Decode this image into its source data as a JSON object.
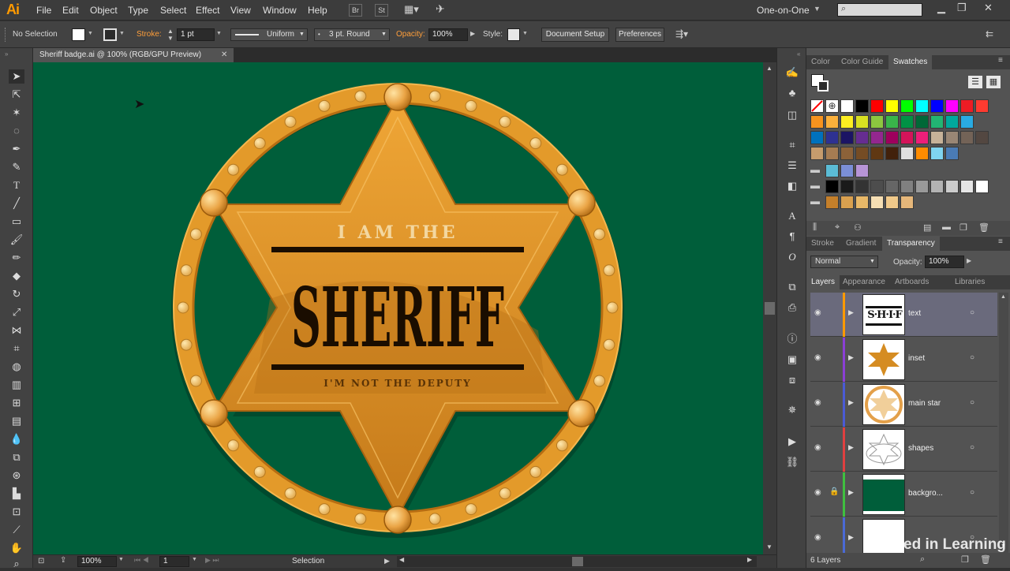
{
  "menubar": {
    "app_logo": "Ai",
    "menus": [
      "File",
      "Edit",
      "Object",
      "Type",
      "Select",
      "Effect",
      "View",
      "Window",
      "Help"
    ],
    "bridge_label": "Br",
    "stock_label": "St",
    "workspace": "One-on-One"
  },
  "control": {
    "selection_status": "No Selection",
    "stroke_label": "Stroke:",
    "stroke_weight": "1 pt",
    "profile": "Uniform",
    "brush": "3 pt. Round",
    "opacity_label": "Opacity:",
    "opacity_value": "100%",
    "style_label": "Style:",
    "document_setup": "Document Setup",
    "preferences": "Preferences"
  },
  "document": {
    "tab_title": "Sheriff badge.ai @ 100% (RGB/GPU Preview)",
    "canvas_color": "#005e3a"
  },
  "artwork": {
    "line1": "I AM THE",
    "line2": "SHERIFF",
    "line3": "I'M NOT THE DEPUTY",
    "gold": "#e39a2a",
    "gold_dark": "#b66d12"
  },
  "status": {
    "zoom": "100%",
    "artboard": "1",
    "tool": "Selection"
  },
  "panels": {
    "swatch_tabs": [
      "Color",
      "Color Guide",
      "Swatches"
    ],
    "swatch_rows": [
      [
        "#ff0000",
        "#ffff00",
        "#00ff00",
        "#00ffff",
        "#0000ff",
        "#ff00ff",
        "#ed1c24",
        "#ff3b30"
      ],
      [
        "#f7931e",
        "#fbb03b",
        "#fcee21",
        "#d9e021",
        "#8cc63f",
        "#39b54a",
        "#009245",
        "#006837",
        "#22b573",
        "#00a99d",
        "#29abe2"
      ],
      [
        "#0071bc",
        "#2e3192",
        "#1b1464",
        "#662d91",
        "#93278f",
        "#9e005d",
        "#d4145a",
        "#ed1e79",
        "#c7b299",
        "#998675",
        "#736357",
        "#534741"
      ],
      [
        "#c69c6d",
        "#a67c52",
        "#8c6239",
        "#754c24",
        "#603813",
        "#42210b",
        "#e0e0e0",
        "#ff8c00",
        "#7fd4f0",
        "#4a7bb5"
      ],
      [
        "#5bbcd6",
        "#7b8fd6",
        "#b794d6"
      ],
      [
        "#000000",
        "#1a1a1a",
        "#333333",
        "#4d4d4d",
        "#666666",
        "#808080",
        "#999999",
        "#b3b3b3",
        "#cccccc",
        "#e6e6e6",
        "#ffffff"
      ],
      [
        "#c47f2a",
        "#d9a04f",
        "#e8b868",
        "#f5deb3",
        "#f0c98a",
        "#e6b77a"
      ]
    ],
    "stroke_tabs": [
      "Stroke",
      "Gradient",
      "Transparency"
    ],
    "blend_mode": "Normal",
    "opacity_label": "Opacity:",
    "opacity_value": "100%",
    "layers_tabs": [
      "Layers",
      "Appearance",
      "Artboards",
      "Libraries"
    ],
    "layers": [
      {
        "name": "text",
        "color": "#ff9a00",
        "selected": true,
        "locked": false
      },
      {
        "name": "inset",
        "color": "#8b3fd6",
        "selected": false,
        "locked": false
      },
      {
        "name": "main star",
        "color": "#4a5bd6",
        "selected": false,
        "locked": false
      },
      {
        "name": "shapes",
        "color": "#e04040",
        "selected": false,
        "locked": false
      },
      {
        "name": "backgro...",
        "color": "#3fc03f",
        "selected": false,
        "locked": true
      },
      {
        "name": "",
        "color": "#4a6ad6",
        "selected": false,
        "locked": false
      }
    ],
    "layer_count": "6 Layers",
    "watermark": "Linked in Learning"
  }
}
